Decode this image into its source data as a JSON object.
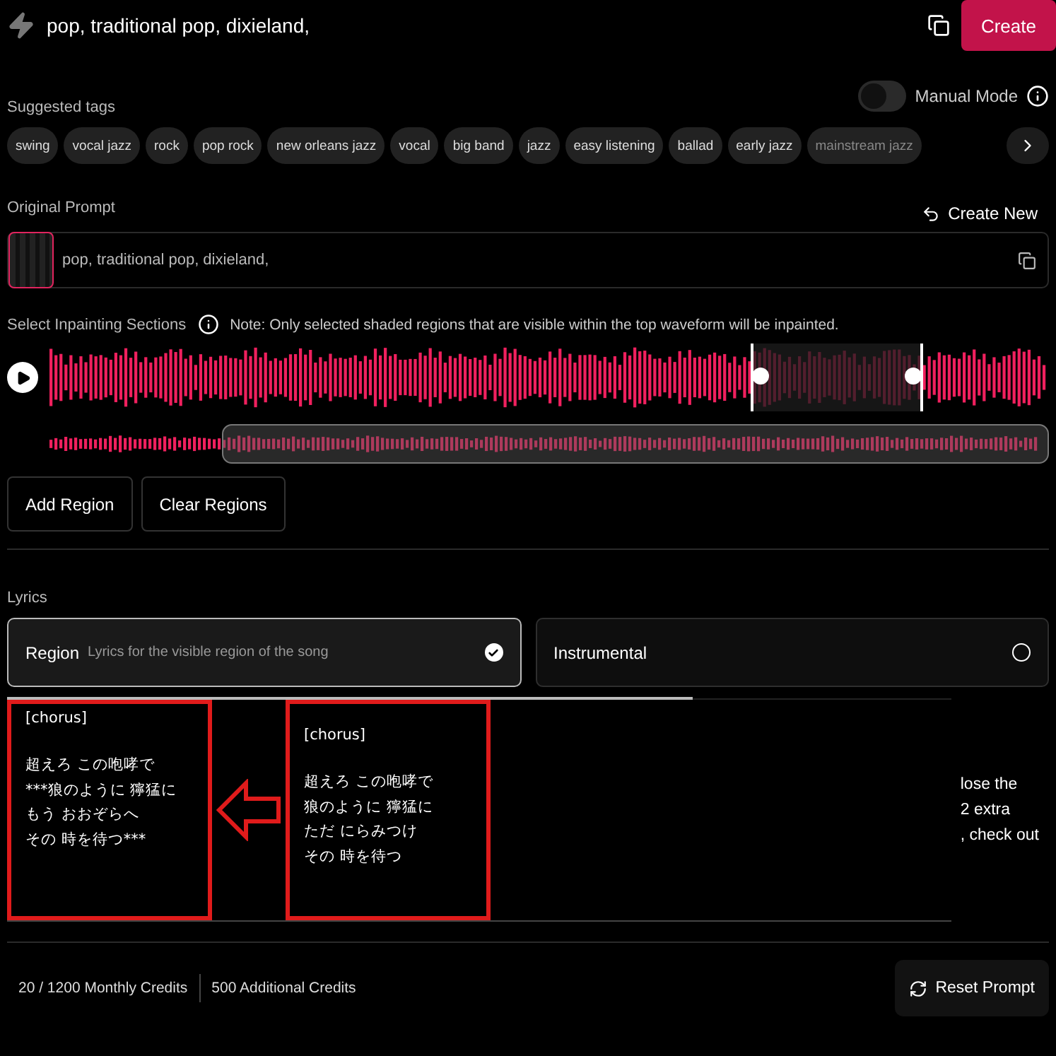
{
  "prompt": "pop, traditional pop, dixieland,",
  "create_button": "Create",
  "manual_mode": {
    "label": "Manual Mode",
    "on": false
  },
  "suggested_tags": {
    "label": "Suggested tags",
    "tags": [
      "swing",
      "vocal jazz",
      "rock",
      "pop rock",
      "new orleans jazz",
      "vocal",
      "big band",
      "jazz",
      "easy listening",
      "ballad",
      "early jazz",
      "mainstream jazz"
    ]
  },
  "original_prompt": {
    "label": "Original Prompt",
    "action": "Create New",
    "text": "pop, traditional pop, dixieland,"
  },
  "inpainting": {
    "label": "Select Inpainting Sections",
    "note": "Note: Only selected shaded regions that are visible within the top waveform will be inpainted."
  },
  "region_buttons": [
    "Add Region",
    "Clear Regions"
  ],
  "lyrics": {
    "label": "Lyrics",
    "options": [
      {
        "title": "Region",
        "hint": "Lyrics for the visible region of the song",
        "selected": true
      },
      {
        "title": "Instrumental",
        "selected": false
      }
    ],
    "edited": {
      "heading": "[chorus]",
      "lines": [
        "超えろ この咆哮で",
        "***狼のように 獰猛に",
        "もう おおぞらへ",
        "その 時を待つ***"
      ]
    },
    "original": {
      "heading": "[chorus]",
      "lines": [
        "超えろ この咆哮で",
        "狼のように 獰猛に",
        "ただ にらみつけ",
        "その 時を待つ"
      ]
    },
    "partial_lines": [
      "lose the",
      "2 extra",
      ", check out"
    ]
  },
  "credits": {
    "monthly": "20 / 1200 Monthly Credits",
    "additional": "500 Additional Credits"
  },
  "reset_button": "Reset Prompt"
}
